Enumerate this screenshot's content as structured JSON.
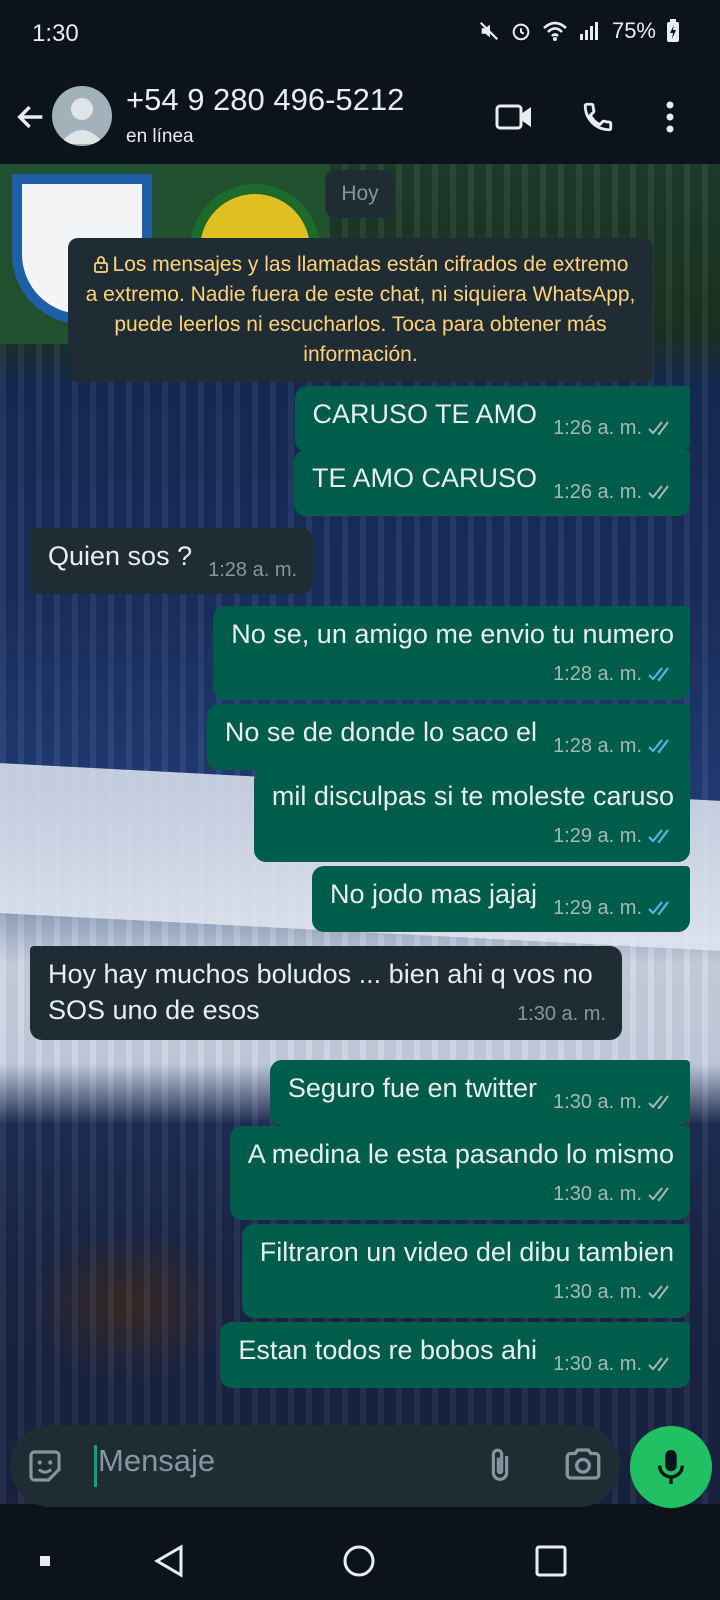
{
  "status_bar": {
    "time": "1:30",
    "battery": "75%",
    "icons": [
      "mute-icon",
      "alarm-icon",
      "wifi-icon",
      "signal-icon",
      "battery-icon"
    ]
  },
  "header": {
    "contact_name": "+54 9 280 496-5212",
    "contact_status": "en línea",
    "icons": [
      "back-arrow-icon",
      "avatar-icon",
      "video-call-icon",
      "phone-icon",
      "more-vert-icon"
    ]
  },
  "chat": {
    "date_chip": "Hoy",
    "encryption_notice": "Los mensajes y las llamadas están cifrados de extremo a extremo. Nadie fuera de este chat, ni siquiera WhatsApp, puede leerlos ni escucharlos. Toca para obtener más información.",
    "messages": [
      {
        "direction": "out",
        "text": "CARUSO TE AMO",
        "time": "1:26 a. m.",
        "status": "read-grey"
      },
      {
        "direction": "out",
        "text": "TE AMO CARUSO",
        "time": "1:26 a. m.",
        "status": "read-grey"
      },
      {
        "direction": "in",
        "text": "Quien sos ?",
        "time": "1:28 a. m."
      },
      {
        "direction": "out",
        "text": "No se, un amigo me envio tu numero",
        "time": "1:28 a. m.",
        "status": "read-blue"
      },
      {
        "direction": "out",
        "text": "No se de donde lo saco el",
        "time": "1:28 a. m.",
        "status": "read-blue"
      },
      {
        "direction": "out",
        "text": "mil disculpas si te moleste caruso",
        "time": "1:29 a. m.",
        "status": "read-blue"
      },
      {
        "direction": "out",
        "text": "No jodo mas jajaj",
        "time": "1:29 a. m.",
        "status": "read-blue"
      },
      {
        "direction": "in",
        "text": "Hoy hay muchos boludos ... bien ahi q vos no SOS uno de esos",
        "time": "1:30 a. m."
      },
      {
        "direction": "out",
        "text": "Seguro fue en twitter",
        "time": "1:30 a. m.",
        "status": "delivered"
      },
      {
        "direction": "out",
        "text": "A medina le esta pasando lo mismo",
        "time": "1:30 a. m.",
        "status": "delivered"
      },
      {
        "direction": "out",
        "text": "Filtraron un video del dibu tambien",
        "time": "1:30 a. m.",
        "status": "delivered"
      },
      {
        "direction": "out",
        "text": "Estan todos re bobos ahi",
        "time": "1:30 a. m.",
        "status": "delivered"
      }
    ]
  },
  "composer": {
    "placeholder": "Mensaje",
    "icons": [
      "emoji-icon",
      "attach-icon",
      "camera-icon",
      "mic-icon"
    ]
  },
  "colors": {
    "background": "#0b141a",
    "outgoing_bubble": "#005c4b",
    "incoming_bubble": "#1f2c34",
    "read_tick": "#53bdeb",
    "accent": "#21c063",
    "notice_text": "#ffd279"
  },
  "nav_bar": {
    "icons": [
      "recents-icon",
      "back-icon",
      "home-icon",
      "overview-icon"
    ]
  }
}
